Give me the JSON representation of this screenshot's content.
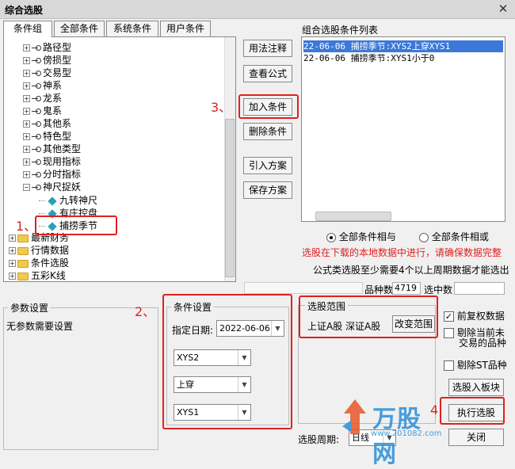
{
  "window": {
    "title": "综合选股",
    "close_glyph": "✕"
  },
  "tabs": [
    {
      "label": "条件组"
    },
    {
      "label": "全部条件"
    },
    {
      "label": "系统条件"
    },
    {
      "label": "用户条件"
    }
  ],
  "tree": {
    "items": [
      {
        "label": "路径型"
      },
      {
        "label": "傍损型"
      },
      {
        "label": "交易型"
      },
      {
        "label": "神系"
      },
      {
        "label": "龙系"
      },
      {
        "label": "鬼系"
      },
      {
        "label": "其他系"
      },
      {
        "label": "特色型"
      },
      {
        "label": "其他类型"
      },
      {
        "label": "现用指标"
      },
      {
        "label": "分时指标"
      },
      {
        "label": "神尺捉妖"
      }
    ],
    "children": [
      {
        "label": "九转神尺"
      },
      {
        "label": "有庄控盘"
      },
      {
        "label": "捕捞季节"
      }
    ],
    "folders": [
      {
        "label": "最新财务"
      },
      {
        "label": "行情数据"
      },
      {
        "label": "条件选股"
      },
      {
        "label": "五彩K线"
      }
    ]
  },
  "middle_buttons": {
    "usage": "用法注释",
    "formula": "查看公式",
    "add": "加入条件",
    "delete": "删除条件",
    "import": "引入方案",
    "save": "保存方案"
  },
  "annotations": {
    "a1": "1、",
    "a2": "2、",
    "a3": "3、",
    "a4": "4"
  },
  "condition_list": {
    "title": "组合选股条件列表",
    "items": [
      {
        "text": "22-06-06 捕捞季节:XYS2上穿XYS1",
        "selected": true
      },
      {
        "text": "22-06-06 捕捞季节:XYS1小于0",
        "selected": false
      }
    ]
  },
  "radios": {
    "all_and": "全部条件相与",
    "all_or": "全部条件相或"
  },
  "notices": {
    "red": "选股在下载的本地数据中进行，请确保数据完整",
    "black": "公式类选股至少需要4个以上周期数据才能选出"
  },
  "counts": {
    "total_label": "品种数",
    "total_value": "4719",
    "selected_label": "选中数",
    "selected_value": ""
  },
  "params": {
    "title": "参数设置",
    "text": "无参数需要设置"
  },
  "condition_settings": {
    "title": "条件设置",
    "date_label": "指定日期:",
    "date_value": "2022-06-06",
    "combo1": "XYS2",
    "combo2": "上穿",
    "combo3": "XYS1"
  },
  "range": {
    "title": "选股范围",
    "text": "上证A股  深证A股",
    "button": "改变范围"
  },
  "options": {
    "prev_rights": "前复权数据",
    "exclude_untraded_1": "剔除当前未",
    "exclude_untraded_2": "交易的品种",
    "exclude_st": "剔除ST品种",
    "to_block": "选股入板块",
    "execute": "执行选股",
    "close": "关闭"
  },
  "period": {
    "label": "选股周期:",
    "value": "日线"
  },
  "watermark": {
    "brand": "万股网",
    "url": "www.201082.com"
  },
  "colors": {
    "accent_red": "#e02020",
    "selection_blue": "#3c78d8"
  }
}
